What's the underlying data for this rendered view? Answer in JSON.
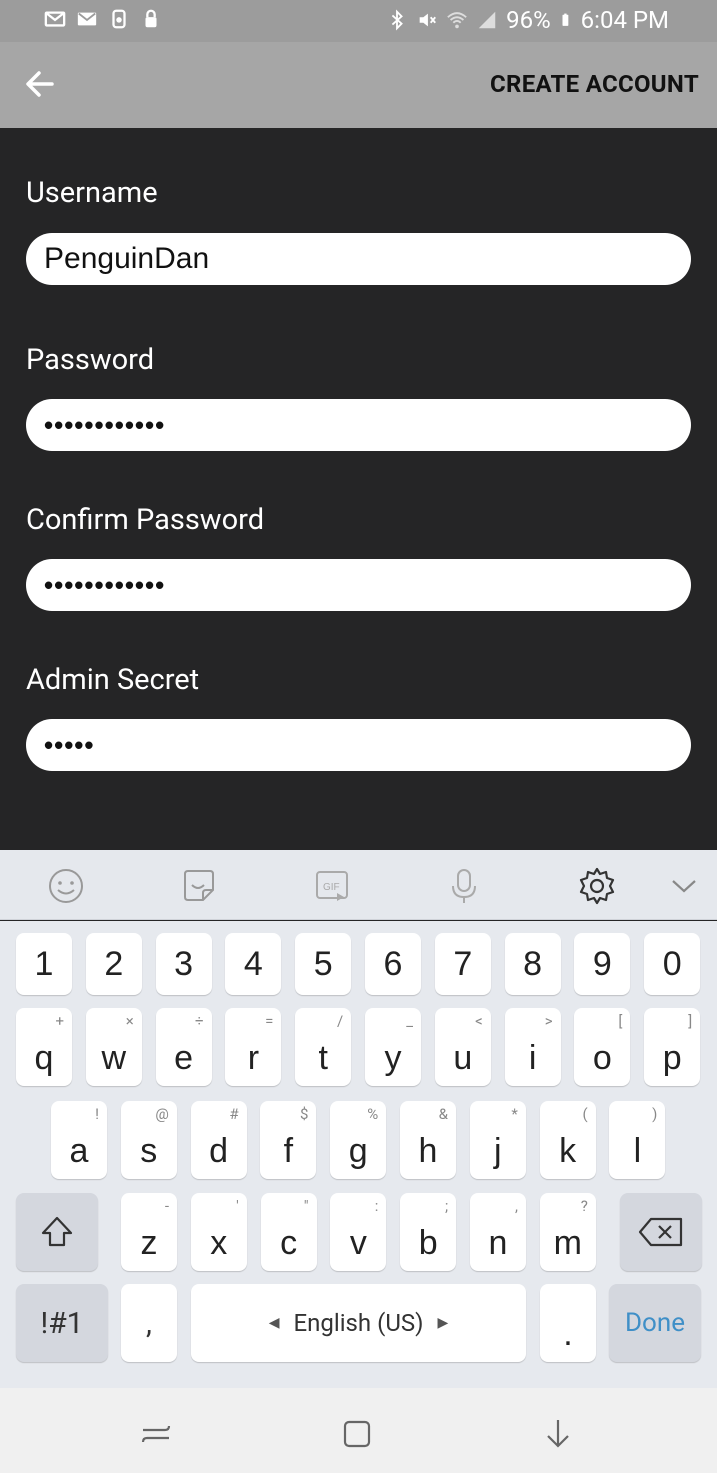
{
  "status_bar": {
    "battery": "96%",
    "time": "6:04 PM",
    "icons_left": [
      "mail-icon",
      "mail-icon",
      "usb-icon",
      "lock-icon"
    ],
    "icons_right": [
      "bluetooth-icon",
      "mute-icon",
      "wifi-icon",
      "signal-icon",
      "battery-icon"
    ]
  },
  "app_bar": {
    "back_icon": "arrow-left-icon",
    "action_label": "CREATE ACCOUNT"
  },
  "form": {
    "username": {
      "label": "Username",
      "value": "PenguinDan"
    },
    "password": {
      "label": "Password",
      "value": "••••••••••••"
    },
    "confirm_password": {
      "label": "Confirm Password",
      "value": "••••••••••••"
    },
    "admin_secret": {
      "label": "Admin Secret",
      "value": "•••••"
    }
  },
  "keyboard": {
    "toolbar": [
      "emoji-icon",
      "sticker-icon",
      "gif-icon",
      "microphone-icon",
      "gear-icon",
      "chevron-down-icon"
    ],
    "number_row": [
      "1",
      "2",
      "3",
      "4",
      "5",
      "6",
      "7",
      "8",
      "9",
      "0"
    ],
    "row1": [
      {
        "k": "q",
        "s": "+"
      },
      {
        "k": "w",
        "s": "×"
      },
      {
        "k": "e",
        "s": "÷"
      },
      {
        "k": "r",
        "s": "="
      },
      {
        "k": "t",
        "s": "/"
      },
      {
        "k": "y",
        "s": "_"
      },
      {
        "k": "u",
        "s": "<"
      },
      {
        "k": "i",
        "s": ">"
      },
      {
        "k": "o",
        "s": "["
      },
      {
        "k": "p",
        "s": "]"
      }
    ],
    "row2": [
      {
        "k": "a",
        "s": "!"
      },
      {
        "k": "s",
        "s": "@"
      },
      {
        "k": "d",
        "s": "#"
      },
      {
        "k": "f",
        "s": "$"
      },
      {
        "k": "g",
        "s": "%"
      },
      {
        "k": "h",
        "s": "&"
      },
      {
        "k": "j",
        "s": "*"
      },
      {
        "k": "k",
        "s": "("
      },
      {
        "k": "l",
        "s": ")"
      }
    ],
    "row3": [
      {
        "k": "z",
        "s": "-"
      },
      {
        "k": "x",
        "s": "'"
      },
      {
        "k": "c",
        "s": "\""
      },
      {
        "k": "v",
        "s": ":"
      },
      {
        "k": "b",
        "s": ";"
      },
      {
        "k": "n",
        "s": ","
      },
      {
        "k": "m",
        "s": "?"
      }
    ],
    "symbols_label": "!#1",
    "comma_label": ",",
    "space_label": "English (US)",
    "period_label": ".",
    "done_label": "Done"
  },
  "nav_bar": [
    "recents-icon",
    "home-icon",
    "back-icon"
  ]
}
